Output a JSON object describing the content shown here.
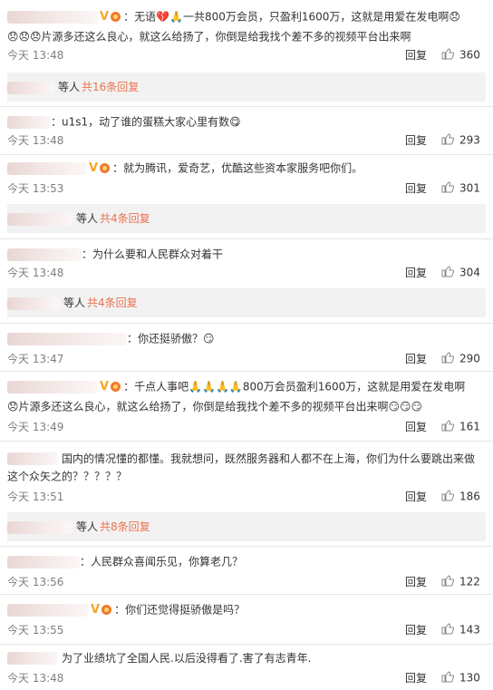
{
  "ui": {
    "reply_label": "回复",
    "time_prefix": "今天",
    "etc_label": "等人"
  },
  "comments": [
    {
      "lines": [
        "：无语💔🙏一共800万会员，只盈利1600万，这就是用爱在发电啊😞",
        "😞😞😞片源多还这么良心，就这么给扬了，你倒是给我找个差不多的视频平台出来啊"
      ],
      "time": "今天 13:48",
      "likes": "360",
      "sub_replies": "共16条回复"
    },
    {
      "lines": [
        "：u1s1，动了谁的蛋糕大家心里有数😋"
      ],
      "time": "今天 13:48",
      "likes": "293"
    },
    {
      "lines": [
        "：就为腾讯，爱奇艺，优酷这些资本家服务吧你们。"
      ],
      "time": "今天 13:53",
      "likes": "301",
      "sub_replies": "共4条回复"
    },
    {
      "lines": [
        "：为什么要和人民群众对着干"
      ],
      "time": "今天 13:48",
      "likes": "304",
      "sub_replies": "共4条回复"
    },
    {
      "lines": [
        "：你还挺骄傲？😏"
      ],
      "time": "今天 13:47",
      "likes": "290"
    },
    {
      "lines": [
        "：千点人事吧🙏🙏🙏🙏800万会员盈利1600万，这就是用爱在发电啊",
        "😞片源多还这么良心，就这么给扬了，你倒是给我找个差不多的视频平台出来啊😏😏😏"
      ],
      "time": "今天 13:49",
      "likes": "161"
    },
    {
      "lines": [
        "国内的情况懂的都懂。我就想问，既然服务器和人都不在上海，你们为什么要跳出来做",
        "这个众矢之的？？？？？"
      ],
      "time": "今天 13:51",
      "likes": "186",
      "sub_replies": "共8条回复"
    },
    {
      "lines": [
        "：人民群众喜闻乐见，你算老几？"
      ],
      "time": "今天 13:56",
      "likes": "122"
    },
    {
      "lines": [
        "：你们还觉得挺骄傲是吗？"
      ],
      "time": "今天 13:55",
      "likes": "143"
    },
    {
      "lines": [
        "为了业绩坑了全国人民.以后没得看了.害了有志青年."
      ],
      "time": "今天 13:48",
      "likes": "130"
    }
  ]
}
